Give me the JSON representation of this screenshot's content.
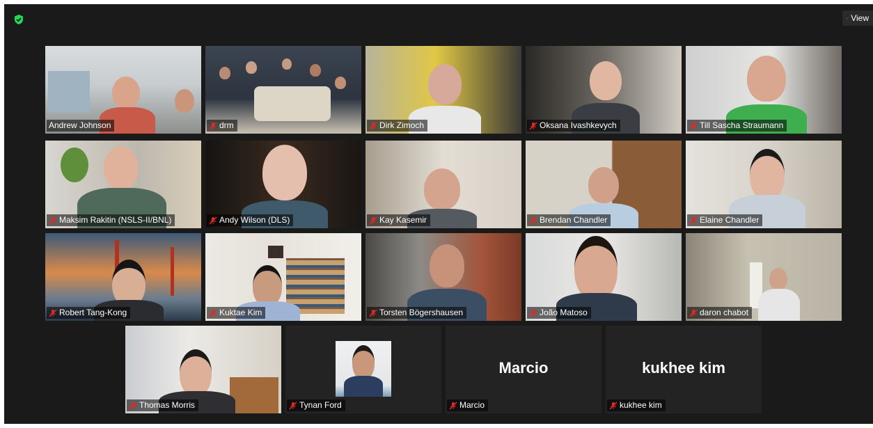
{
  "toolbar": {
    "view_label": "View",
    "shield_color": "#23d959"
  },
  "participants": [
    {
      "name": "Andrew Johnson",
      "muted": false,
      "active": true
    },
    {
      "name": "drm",
      "muted": true
    },
    {
      "name": "Dirk Zimoch",
      "muted": true
    },
    {
      "name": "Oksana Ivashkevych",
      "muted": true
    },
    {
      "name": "Till Sascha Straumann",
      "muted": true
    },
    {
      "name": "Maksim Rakitin (NSLS-II/BNL)",
      "muted": true
    },
    {
      "name": "Andy Wilson (DLS)",
      "muted": true
    },
    {
      "name": "Kay Kasemir",
      "muted": true
    },
    {
      "name": "Brendan Chandler",
      "muted": true
    },
    {
      "name": "Elaine Chandler",
      "muted": true
    },
    {
      "name": "Robert Tang-Kong",
      "muted": true
    },
    {
      "name": "Kuktae Kim",
      "muted": true
    },
    {
      "name": "Torsten Bögershausen",
      "muted": true
    },
    {
      "name": "João Matoso",
      "muted": true
    },
    {
      "name": "daron chabot",
      "muted": true
    },
    {
      "name": "Thomas Morris",
      "muted": true
    },
    {
      "name": "Tynan Ford",
      "muted": true
    },
    {
      "name": "Marcio",
      "muted": true,
      "video_off": true,
      "big_name": "Marcio"
    },
    {
      "name": "kukhee kim",
      "muted": true,
      "video_off": true,
      "big_name": "kukhee kim"
    }
  ],
  "colors": {
    "muted_red": "#e02828",
    "active_border": "#b9d96a",
    "background": "#1a1a1a"
  }
}
